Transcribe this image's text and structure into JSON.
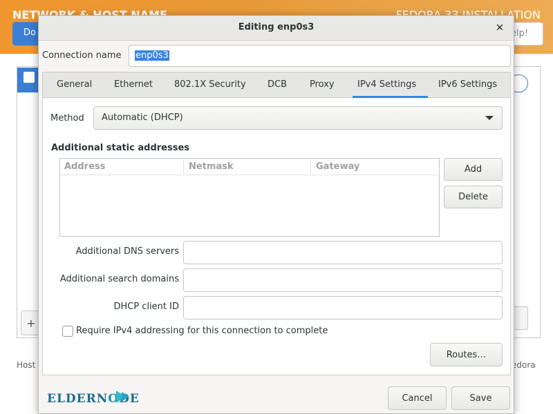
{
  "background": {
    "header_title": "NETWORK & HOST NAME",
    "header_subtitle": "FEDORA 33 INSTALLATION",
    "done_button": "Do",
    "help_button": "elp!",
    "hostname_label": "Host",
    "fedora_text": "edora"
  },
  "dialog": {
    "title": "Editing enp0s3",
    "close_glyph": "✕",
    "connection_name_label": "Connection name",
    "connection_name_value": "enp0s3",
    "tabs": [
      {
        "label": "General"
      },
      {
        "label": "Ethernet"
      },
      {
        "label": "802.1X Security"
      },
      {
        "label": "DCB"
      },
      {
        "label": "Proxy"
      },
      {
        "label": "IPv4 Settings"
      },
      {
        "label": "IPv6 Settings"
      }
    ],
    "active_tab": "IPv4 Settings",
    "method_label": "Method",
    "method_value": "Automatic (DHCP)",
    "static_addresses_label": "Additional static addresses",
    "address_columns": [
      "Address",
      "Netmask",
      "Gateway"
    ],
    "add_button": "Add",
    "delete_button": "Delete",
    "dns_label": "Additional DNS servers",
    "search_domains_label": "Additional search domains",
    "dhcp_client_id_label": "DHCP client ID",
    "require_ipv4_label": "Require IPv4 addressing for this connection to complete",
    "routes_button": "Routes…",
    "cancel_button": "Cancel",
    "save_button": "Save"
  },
  "watermark": {
    "logo_text_a": "ELDERN",
    "logo_text_o": "O",
    "logo_text_b": "DE"
  },
  "colors": {
    "accent": "#3584e4",
    "header_orange": "#f0962e",
    "done_blue": "#3b7ed6"
  }
}
